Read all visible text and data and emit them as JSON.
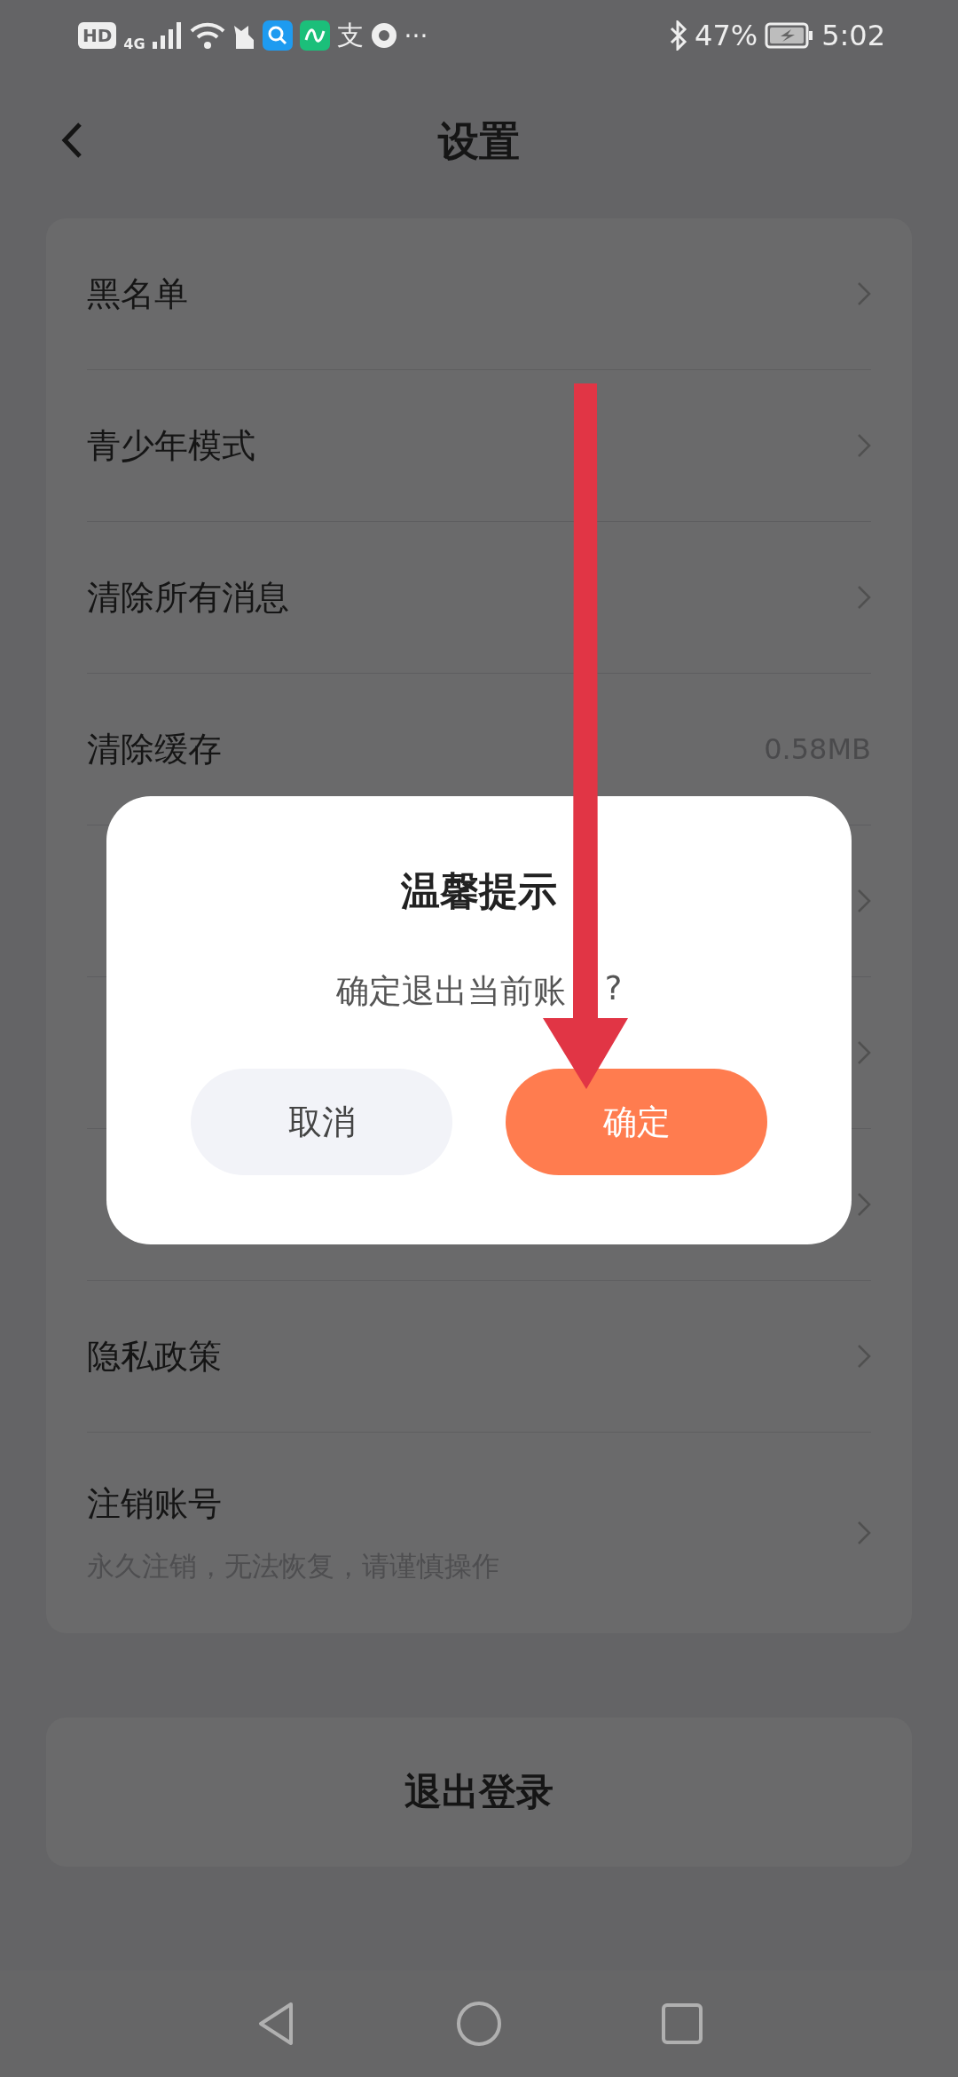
{
  "status_bar": {
    "left": [
      "HD",
      "4G",
      "支",
      "···"
    ],
    "battery": "47%",
    "time": "5:02"
  },
  "header": {
    "title": "设置"
  },
  "settings": [
    {
      "label": "黑名单",
      "chevron": true
    },
    {
      "label": "青少年模式",
      "chevron": true
    },
    {
      "label": "清除所有消息",
      "chevron": true
    },
    {
      "label": "清除缓存",
      "value": "0.58MB",
      "chevron": false
    },
    {
      "chevron": true
    },
    {
      "chevron": true
    },
    {
      "chevron": true
    },
    {
      "label": "隐私政策",
      "chevron": true
    },
    {
      "label": "注销账号",
      "subtitle": "永久注销，无法恢复，请谨慎操作",
      "chevron": true
    }
  ],
  "logout_button": "退出登录",
  "dialog": {
    "title": "温馨提示",
    "message": [
      "确定退出当前账",
      "?"
    ],
    "buttons": [
      {
        "label": "取消",
        "kind": "secondary"
      },
      {
        "label": "确定",
        "kind": "primary"
      }
    ]
  }
}
